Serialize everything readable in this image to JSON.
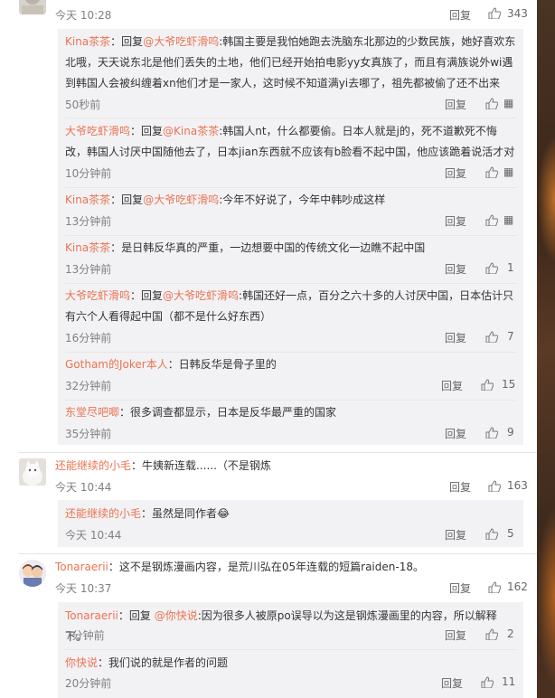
{
  "top": {
    "time": "今天 10:28",
    "reply": "回复",
    "likes": "343"
  },
  "subreplies1": [
    {
      "user": "Kina茶茶",
      "prefix": "：回复",
      "mention": "@大爷吃虾滑呜",
      "text": ":韩国主要是我怕她跑去洗脑东北那边的少数民族，她好喜欢东北哦，天天说东北是他们丢失的土地，他们已经开始拍电影yy女真族了，而且有满族说外wi遇到韩国人会被纠缠着xn他们才是一家人，这时候不知道满yi去哪了，祖先都被偷了还不出来",
      "time": "50秒前",
      "reply": "回复",
      "likes": ""
    },
    {
      "user": "大爷吃虾滑呜",
      "prefix": "：回复",
      "mention": "@Kina茶茶",
      "text": ":韩国人nt，什么都要偷。日本人就是j的，死不道歉死不悔改，韩国人讨厌中国随他去了，日本jian东西就不应该有b脸看不起中国，他应该跪着说活才对",
      "time": "10分钟前",
      "reply": "回复",
      "likes": ""
    },
    {
      "user": "Kina茶茶",
      "prefix": "：回复",
      "mention": "@大爷吃虾滑呜",
      "text": ":今年不好说了，今年中韩吵成这样",
      "time": "13分钟前",
      "reply": "回复",
      "likes": ""
    },
    {
      "user": "Kina茶茶",
      "prefix": "：",
      "mention": "",
      "text": "是日韩反华真的严重，一边想要中国的传统文化一边瞧不起中国",
      "time": "13分钟前",
      "reply": "回复",
      "likes": "1"
    },
    {
      "user": "大爷吃虾滑呜",
      "prefix": "：回复",
      "mention": "@大爷吃虾滑呜",
      "text": ":韩国还好一点，百分之六十多的人讨厌中国，日本估计只有六个人看得起中国（都不是什么好东西）",
      "time": "16分钟前",
      "reply": "回复",
      "likes": "7"
    },
    {
      "user": "Gotham的Joker本人",
      "prefix": "：",
      "mention": "",
      "text": "日韩反华是骨子里的",
      "time": "32分钟前",
      "reply": "回复",
      "likes": "15"
    },
    {
      "user": "东堂尽吧唧",
      "prefix": "：",
      "mention": "",
      "text": "很多调查都显示，日本是反华最严重的国家",
      "time": "35分钟前",
      "reply": "回复",
      "likes": "9"
    }
  ],
  "comment2": {
    "user": "还能继续的小毛",
    "text": "：牛姨新连载......（不是钢炼",
    "time": "今天 10:44",
    "reply": "回复",
    "likes": "163",
    "sub": {
      "user": "还能继续的小毛",
      "text": "：虽然是同作者😂",
      "time": "今天 10:44",
      "reply": "回复",
      "likes": "5"
    }
  },
  "comment3": {
    "user": "Tonaraerii",
    "text": "：这不是钢炼漫画内容，是荒川弘在05年连载的短篇raiden-18。",
    "time": "今天 10:37",
    "reply": "回复",
    "likes": "162",
    "subs": [
      {
        "user": "Tonaraerii",
        "prefix": "：回复 ",
        "mention": "@你快说",
        "text": ":因为很多人被原po误导以为这是钢炼漫画里的内容，所以解释下。",
        "time": "7分钟前",
        "reply": "回复",
        "likes": "2"
      },
      {
        "user": "你快说",
        "prefix": "：",
        "mention": "",
        "text": "我们说的就是作者的问题",
        "time": "20分钟前",
        "reply": "回复",
        "likes": "11"
      }
    ]
  },
  "colors": {
    "name": "#eb7350",
    "card": "#f2f2f5",
    "text": "#333333",
    "meta": "#808080"
  },
  "icons": {
    "like": "thumb-up-icon",
    "report": "report-icon"
  }
}
